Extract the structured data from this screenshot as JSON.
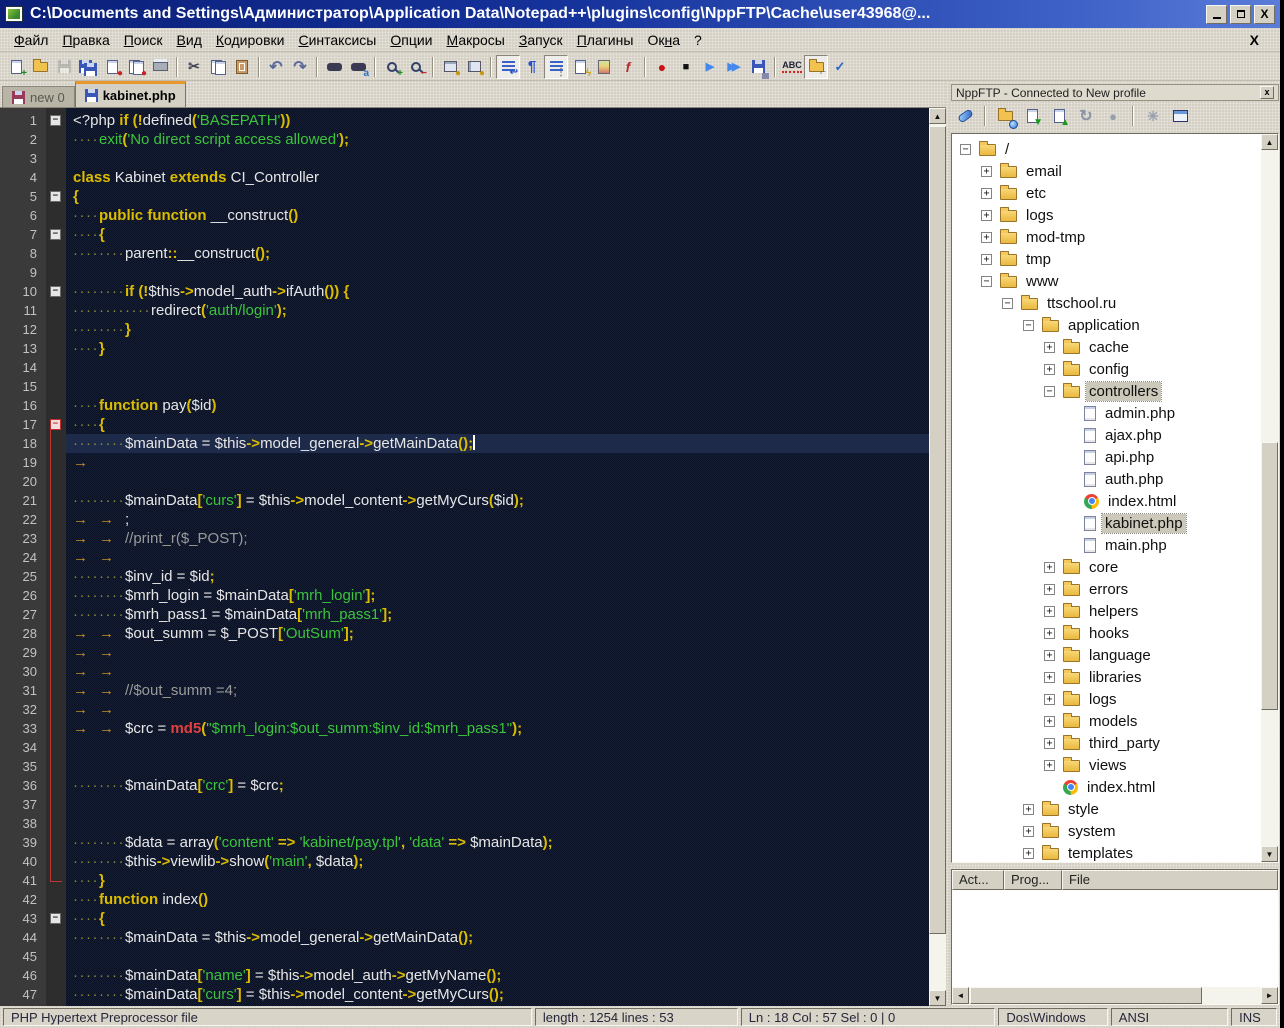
{
  "window": {
    "title": "C:\\Documents and Settings\\Администратор\\Application Data\\Notepad++\\plugins\\config\\NppFTP\\Cache\\user43968@...",
    "controls": [
      "minimize",
      "restore",
      "close"
    ]
  },
  "menu": {
    "items": [
      {
        "label": "Файл",
        "u": 0
      },
      {
        "label": "Правка",
        "u": 0
      },
      {
        "label": "Поиск",
        "u": 0
      },
      {
        "label": "Вид",
        "u": 0
      },
      {
        "label": "Кодировки",
        "u": 0
      },
      {
        "label": "Синтаксисы",
        "u": 0
      },
      {
        "label": "Опции",
        "u": 0
      },
      {
        "label": "Макросы",
        "u": 0
      },
      {
        "label": "Запуск",
        "u": 0
      },
      {
        "label": "Плагины",
        "u": 0
      },
      {
        "label": "Окна",
        "u": 2
      },
      {
        "label": "?",
        "u": -1
      }
    ],
    "close_label": "X"
  },
  "toolbar": {
    "groups": [
      [
        "new-file",
        "open-file",
        {
          "name": "save",
          "disabled": true
        },
        "save-all",
        "close-file",
        "close-all",
        "print"
      ],
      [
        "cut",
        "copy",
        "paste"
      ],
      [
        "undo",
        "redo"
      ],
      [
        "find",
        "replace"
      ],
      [
        "zoom-in",
        "zoom-out"
      ],
      [
        "sync-scroll-vertical",
        "sync-scroll-horizontal"
      ],
      [
        {
          "name": "word-wrap",
          "pressed": true
        },
        "show-all-characters",
        {
          "name": "indent-guides",
          "pressed": true
        },
        "define-language",
        "document-map",
        "function-list"
      ],
      [
        "macro-record",
        "macro-stop",
        "macro-play",
        "macro-run-multiple",
        "macro-save"
      ],
      [
        "spell-check",
        {
          "name": "spell-settings",
          "pressed": true
        },
        "auto-spell-check"
      ]
    ]
  },
  "tabs": [
    {
      "label": "new 0",
      "active": false,
      "icon": "floppy-red"
    },
    {
      "label": "kabinet.php",
      "active": true,
      "icon": "floppy-blue"
    }
  ],
  "editor": {
    "current_line": 18,
    "fold_boxes": [
      1,
      5,
      7,
      10,
      17,
      43
    ],
    "fold_active": 17,
    "lines": [
      [
        [
          "w",
          "<?php "
        ],
        [
          "k",
          "if "
        ],
        [
          "o",
          "(!"
        ],
        [
          "w",
          "defined"
        ],
        [
          "o",
          "("
        ],
        [
          "s",
          "'BASEPATH'"
        ],
        [
          "o",
          "))"
        ]
      ],
      [
        [
          "d",
          "····"
        ],
        [
          "s",
          "exit"
        ],
        [
          "o",
          "("
        ],
        [
          "s",
          "'No direct script access allowed'"
        ],
        [
          "o",
          ");"
        ]
      ],
      [],
      [
        [
          "k",
          "class "
        ],
        [
          "w",
          "Kabinet "
        ],
        [
          "k",
          "extends "
        ],
        [
          "w",
          "CI_Controller"
        ]
      ],
      [
        [
          "o",
          "{"
        ]
      ],
      [
        [
          "d",
          "····"
        ],
        [
          "k",
          "public "
        ],
        [
          "k",
          "function "
        ],
        [
          "w",
          "__construct"
        ],
        [
          "o",
          "()"
        ]
      ],
      [
        [
          "d",
          "····"
        ],
        [
          "o",
          "{"
        ]
      ],
      [
        [
          "d",
          "········"
        ],
        [
          "w",
          "parent"
        ],
        [
          "o",
          "::"
        ],
        [
          "w",
          "__construct"
        ],
        [
          "o",
          "();"
        ]
      ],
      [],
      [
        [
          "d",
          "········"
        ],
        [
          "k",
          "if "
        ],
        [
          "o",
          "(!"
        ],
        [
          "w",
          "$this"
        ],
        [
          "o",
          "->"
        ],
        [
          "w",
          "model_auth"
        ],
        [
          "o",
          "->"
        ],
        [
          "w",
          "ifAuth"
        ],
        [
          "o",
          "()) {"
        ]
      ],
      [
        [
          "d",
          "············"
        ],
        [
          "w",
          "redirect"
        ],
        [
          "o",
          "("
        ],
        [
          "s",
          "'auth/login'"
        ],
        [
          "o",
          ");"
        ]
      ],
      [
        [
          "d",
          "········"
        ],
        [
          "o",
          "}"
        ]
      ],
      [
        [
          "d",
          "····"
        ],
        [
          "o",
          "}"
        ]
      ],
      [],
      [],
      [
        [
          "d",
          "····"
        ],
        [
          "k",
          "function "
        ],
        [
          "w",
          "pay"
        ],
        [
          "o",
          "("
        ],
        [
          "w",
          "$id"
        ],
        [
          "o",
          ")"
        ]
      ],
      [
        [
          "d",
          "····"
        ],
        [
          "o",
          "{"
        ]
      ],
      [
        [
          "d",
          "········"
        ],
        [
          "w",
          "$mainData = $this"
        ],
        [
          "o",
          "->"
        ],
        [
          "w",
          "model_general"
        ],
        [
          "o",
          "->"
        ],
        [
          "w",
          "getMainData"
        ],
        [
          "o",
          "();"
        ],
        [
          "caret",
          ""
        ]
      ],
      [
        [
          "t",
          "→"
        ]
      ],
      [],
      [
        [
          "d",
          "········"
        ],
        [
          "w",
          "$mainData"
        ],
        [
          "o",
          "["
        ],
        [
          "s",
          "'curs'"
        ],
        [
          "o",
          "]"
        ],
        [
          "w",
          " = $this"
        ],
        [
          "o",
          "->"
        ],
        [
          "w",
          "model_content"
        ],
        [
          "o",
          "->"
        ],
        [
          "w",
          "getMyCurs"
        ],
        [
          "o",
          "("
        ],
        [
          "w",
          "$id"
        ],
        [
          "o",
          ");"
        ]
      ],
      [
        [
          "t",
          "→"
        ],
        [
          "t",
          "→"
        ],
        [
          "w",
          ";"
        ]
      ],
      [
        [
          "t",
          "→"
        ],
        [
          "t",
          "→"
        ],
        [
          "c",
          "//print_r($_POST);"
        ]
      ],
      [
        [
          "t",
          "→"
        ],
        [
          "t",
          "→"
        ]
      ],
      [
        [
          "d",
          "········"
        ],
        [
          "w",
          "$inv_id = $id"
        ],
        [
          "o",
          ";"
        ]
      ],
      [
        [
          "d",
          "········"
        ],
        [
          "w",
          "$mrh_login = $mainData"
        ],
        [
          "o",
          "["
        ],
        [
          "s",
          "'mrh_login'"
        ],
        [
          "o",
          "];"
        ]
      ],
      [
        [
          "d",
          "········"
        ],
        [
          "w",
          "$mrh_pass1 = $mainData"
        ],
        [
          "o",
          "["
        ],
        [
          "s",
          "'mrh_pass1'"
        ],
        [
          "o",
          "];"
        ]
      ],
      [
        [
          "t",
          "→"
        ],
        [
          "t",
          "→"
        ],
        [
          "w",
          "$out_summ = $_POST"
        ],
        [
          "o",
          "["
        ],
        [
          "s",
          "'OutSum'"
        ],
        [
          "o",
          "];"
        ]
      ],
      [
        [
          "t",
          "→"
        ],
        [
          "t",
          "→"
        ]
      ],
      [
        [
          "t",
          "→"
        ],
        [
          "t",
          "→"
        ]
      ],
      [
        [
          "t",
          "→"
        ],
        [
          "t",
          "→"
        ],
        [
          "c",
          "//$out_summ =4;"
        ]
      ],
      [
        [
          "t",
          "→"
        ],
        [
          "t",
          "→"
        ]
      ],
      [
        [
          "t",
          "→"
        ],
        [
          "t",
          "→"
        ],
        [
          "w",
          "$crc = "
        ],
        [
          "r",
          "md5"
        ],
        [
          "o",
          "("
        ],
        [
          "s",
          "\"$mrh_login:$out_summ:$inv_id:$mrh_pass1\""
        ],
        [
          "o",
          ");"
        ]
      ],
      [],
      [],
      [
        [
          "d",
          "········"
        ],
        [
          "w",
          "$mainData"
        ],
        [
          "o",
          "["
        ],
        [
          "s",
          "'crc'"
        ],
        [
          "o",
          "]"
        ],
        [
          "w",
          " = $crc"
        ],
        [
          "o",
          ";"
        ]
      ],
      [],
      [],
      [
        [
          "d",
          "········"
        ],
        [
          "w",
          "$data = array"
        ],
        [
          "o",
          "("
        ],
        [
          "s",
          "'content'"
        ],
        [
          "o",
          " => "
        ],
        [
          "s",
          "'kabinet/pay.tpl'"
        ],
        [
          "o",
          ", "
        ],
        [
          "s",
          "'data'"
        ],
        [
          "o",
          " => "
        ],
        [
          "w",
          "$mainData"
        ],
        [
          "o",
          ");"
        ]
      ],
      [
        [
          "d",
          "········"
        ],
        [
          "w",
          "$this"
        ],
        [
          "o",
          "->"
        ],
        [
          "w",
          "viewlib"
        ],
        [
          "o",
          "->"
        ],
        [
          "w",
          "show"
        ],
        [
          "o",
          "("
        ],
        [
          "s",
          "'main'"
        ],
        [
          "o",
          ", "
        ],
        [
          "w",
          "$data"
        ],
        [
          "o",
          ");"
        ]
      ],
      [
        [
          "d",
          "····"
        ],
        [
          "o",
          "}"
        ]
      ],
      [
        [
          "d",
          "····"
        ],
        [
          "k",
          "function "
        ],
        [
          "w",
          "index"
        ],
        [
          "o",
          "()"
        ]
      ],
      [
        [
          "d",
          "····"
        ],
        [
          "o",
          "{"
        ]
      ],
      [
        [
          "d",
          "········"
        ],
        [
          "w",
          "$mainData = $this"
        ],
        [
          "o",
          "->"
        ],
        [
          "w",
          "model_general"
        ],
        [
          "o",
          "->"
        ],
        [
          "w",
          "getMainData"
        ],
        [
          "o",
          "();"
        ]
      ],
      [],
      [
        [
          "d",
          "········"
        ],
        [
          "w",
          "$mainData"
        ],
        [
          "o",
          "["
        ],
        [
          "s",
          "'name'"
        ],
        [
          "o",
          "]"
        ],
        [
          "w",
          " = $this"
        ],
        [
          "o",
          "->"
        ],
        [
          "w",
          "model_auth"
        ],
        [
          "o",
          "->"
        ],
        [
          "w",
          "getMyName"
        ],
        [
          "o",
          "();"
        ]
      ],
      [
        [
          "d",
          "········"
        ],
        [
          "w",
          "$mainData"
        ],
        [
          "o",
          "["
        ],
        [
          "s",
          "'curs'"
        ],
        [
          "o",
          "]"
        ],
        [
          "w",
          " = $this"
        ],
        [
          "o",
          "->"
        ],
        [
          "w",
          "model_content"
        ],
        [
          "o",
          "->"
        ],
        [
          "w",
          "getMyCurs"
        ],
        [
          "o",
          "();"
        ]
      ]
    ]
  },
  "ftp": {
    "title": "NppFTP - Connected to New profile",
    "close_label": "x",
    "toolbar": [
      "connect",
      "folder-sync",
      "download",
      "upload",
      "refresh",
      "abort",
      "settings",
      "messages"
    ],
    "tree": [
      {
        "label": "/",
        "level": 0,
        "toggle": "minus",
        "icon": "folder"
      },
      {
        "label": "email",
        "level": 1,
        "toggle": "plus",
        "icon": "folder"
      },
      {
        "label": "etc",
        "level": 1,
        "toggle": "plus",
        "icon": "folder"
      },
      {
        "label": "logs",
        "level": 1,
        "toggle": "plus",
        "icon": "folder"
      },
      {
        "label": "mod-tmp",
        "level": 1,
        "toggle": "plus",
        "icon": "folder"
      },
      {
        "label": "tmp",
        "level": 1,
        "toggle": "plus",
        "icon": "folder"
      },
      {
        "label": "www",
        "level": 1,
        "toggle": "minus",
        "icon": "folder"
      },
      {
        "label": "ttschool.ru",
        "level": 2,
        "toggle": "minus",
        "icon": "folder"
      },
      {
        "label": "application",
        "level": 3,
        "toggle": "minus",
        "icon": "folder"
      },
      {
        "label": "cache",
        "level": 4,
        "toggle": "plus",
        "icon": "folder"
      },
      {
        "label": "config",
        "level": 4,
        "toggle": "plus",
        "icon": "folder"
      },
      {
        "label": "controllers",
        "level": 4,
        "toggle": "minus",
        "icon": "folder",
        "selected": true
      },
      {
        "label": "admin.php",
        "level": 5,
        "icon": "file"
      },
      {
        "label": "ajax.php",
        "level": 5,
        "icon": "file"
      },
      {
        "label": "api.php",
        "level": 5,
        "icon": "file"
      },
      {
        "label": "auth.php",
        "level": 5,
        "icon": "file"
      },
      {
        "label": "index.html",
        "level": 5,
        "icon": "chrome"
      },
      {
        "label": "kabinet.php",
        "level": 5,
        "icon": "file",
        "selected": true
      },
      {
        "label": "main.php",
        "level": 5,
        "icon": "file"
      },
      {
        "label": "core",
        "level": 4,
        "toggle": "plus",
        "icon": "folder"
      },
      {
        "label": "errors",
        "level": 4,
        "toggle": "plus",
        "icon": "folder"
      },
      {
        "label": "helpers",
        "level": 4,
        "toggle": "plus",
        "icon": "folder"
      },
      {
        "label": "hooks",
        "level": 4,
        "toggle": "plus",
        "icon": "folder"
      },
      {
        "label": "language",
        "level": 4,
        "toggle": "plus",
        "icon": "folder"
      },
      {
        "label": "libraries",
        "level": 4,
        "toggle": "plus",
        "icon": "folder"
      },
      {
        "label": "logs",
        "level": 4,
        "toggle": "plus",
        "icon": "folder"
      },
      {
        "label": "models",
        "level": 4,
        "toggle": "plus",
        "icon": "folder"
      },
      {
        "label": "third_party",
        "level": 4,
        "toggle": "plus",
        "icon": "folder"
      },
      {
        "label": "views",
        "level": 4,
        "toggle": "plus",
        "icon": "folder"
      },
      {
        "label": "index.html",
        "level": 4,
        "icon": "chrome"
      },
      {
        "label": "style",
        "level": 3,
        "toggle": "plus",
        "icon": "folder"
      },
      {
        "label": "system",
        "level": 3,
        "toggle": "plus",
        "icon": "folder"
      },
      {
        "label": "templates",
        "level": 3,
        "toggle": "plus",
        "icon": "folder"
      }
    ]
  },
  "transfers": {
    "columns": [
      "Act...",
      "Prog...",
      "File"
    ]
  },
  "status": {
    "doc_type": "PHP Hypertext Preprocessor file",
    "length_lines": "length : 1254    lines : 53",
    "caret": "Ln : 18    Col : 57    Sel : 0 | 0",
    "eol": "Dos\\Windows",
    "encoding": "ANSI",
    "mode": "INS"
  }
}
